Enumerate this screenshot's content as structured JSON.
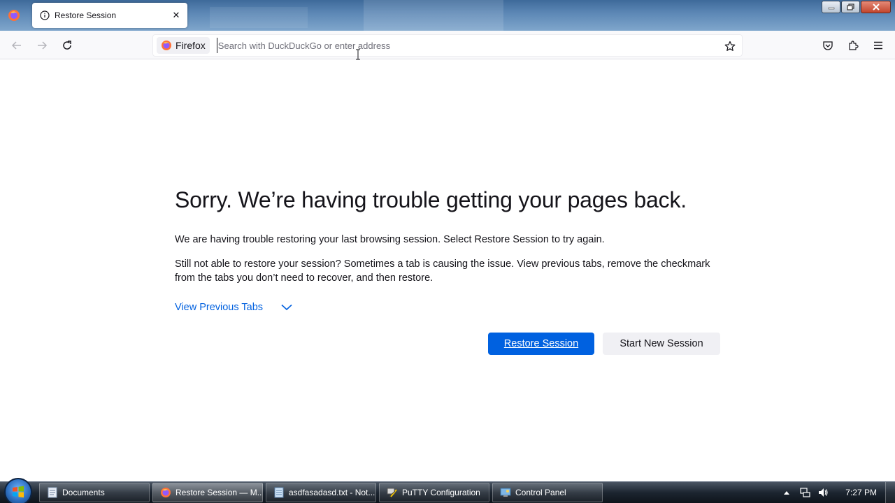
{
  "browser": {
    "tab": {
      "title": "Restore Session",
      "close_glyph": "✕"
    },
    "urlbar": {
      "identity_label": "Firefox",
      "placeholder": "Search with DuckDuckGo or enter address",
      "value": ""
    },
    "icons": [
      "firefox-menu-icon",
      "info-icon",
      "close-icon",
      "back-arrow-icon",
      "forward-arrow-icon",
      "reload-icon",
      "bookmark-star-icon",
      "pocket-icon",
      "extensions-icon",
      "hamburger-menu-icon"
    ]
  },
  "page": {
    "headline": "Sorry. We’re having trouble getting your pages back.",
    "paragraph1": "We are having trouble restoring your last browsing session. Select Restore Session to try again.",
    "paragraph2": "Still not able to restore your session? Sometimes a tab is causing the issue. View previous tabs, remove the checkmark from the tabs you don’t need to recover, and then restore.",
    "view_previous_tabs": "View Previous Tabs",
    "restore_button": "Restore Session",
    "new_session_button": "Start New Session"
  },
  "taskbar": {
    "items": [
      {
        "label": "Documents",
        "active": false
      },
      {
        "label": "Restore Session — M...",
        "active": true
      },
      {
        "label": "asdfasadasd.txt - Not...",
        "active": false
      },
      {
        "label": "PuTTY Configuration",
        "active": false
      },
      {
        "label": "Control Panel",
        "active": false
      }
    ],
    "clock": "7:27 PM"
  },
  "colors": {
    "accent": "#0061e0",
    "link": "#0060df",
    "text": "#15141a"
  }
}
